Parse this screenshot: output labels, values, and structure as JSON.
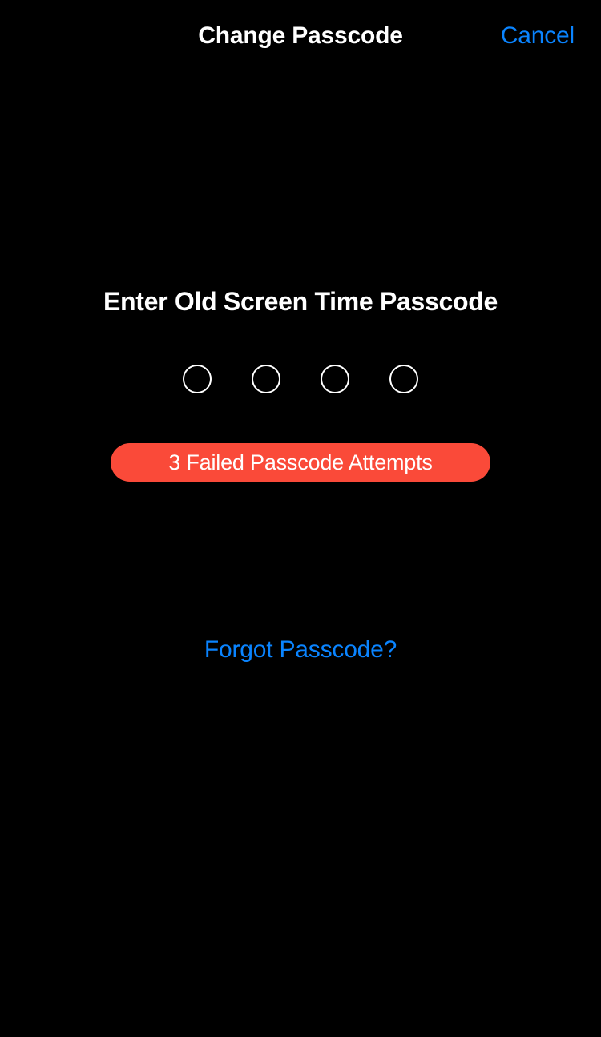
{
  "screen": {
    "name": "screen-time-change-passcode",
    "background_color": "#000000"
  },
  "header": {
    "title": "Change Passcode",
    "cancel_label": "Cancel",
    "title_color": "#FFFFFF",
    "cancel_color": "#0A84FF"
  },
  "main": {
    "prompt_title": "Enter Old Screen Time Passcode",
    "prompt_color": "#FFFFFF",
    "passcode": {
      "length": 4,
      "entered_count": 0,
      "dot_states": [
        "empty",
        "empty",
        "empty",
        "empty"
      ],
      "dot_border_color": "#FFFFFF"
    },
    "attempts_banner": {
      "label": "3 Failed Passcode Attempts",
      "count": 3,
      "background_color": "#FA4A39",
      "text_color": "#FFFFFF"
    },
    "forgot_link": {
      "label": "Forgot Passcode?",
      "color": "#0A84FF"
    }
  }
}
